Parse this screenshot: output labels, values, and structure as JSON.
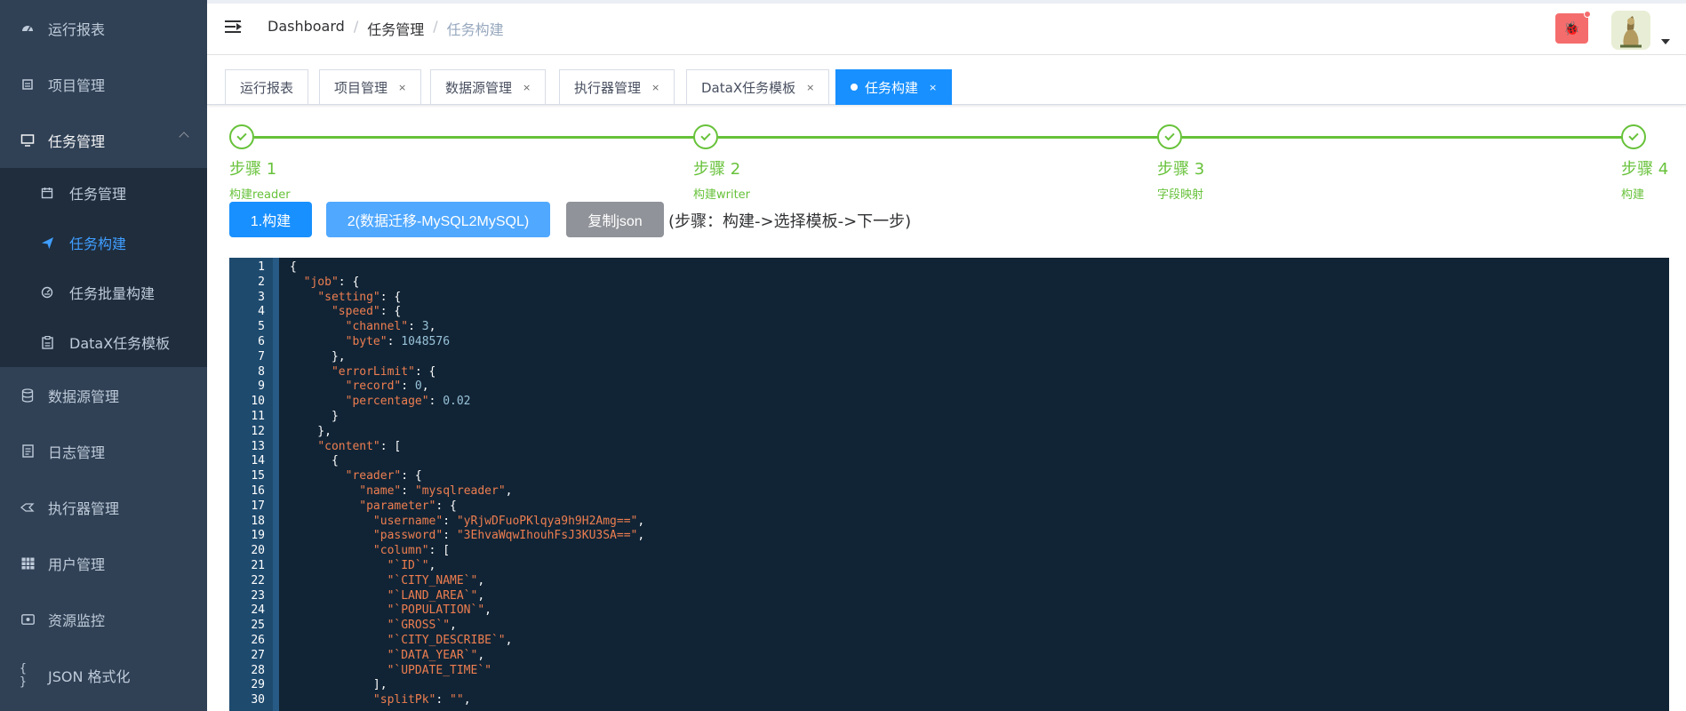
{
  "sidebar": {
    "items": [
      {
        "label": "运行报表",
        "icon": "dashboard-icon"
      },
      {
        "label": "项目管理",
        "icon": "project-icon"
      },
      {
        "label": "任务管理",
        "icon": "monitor-icon"
      }
    ],
    "submenu": [
      {
        "label": "任务管理",
        "icon": "calendar-icon"
      },
      {
        "label": "任务构建",
        "icon": "send-icon"
      },
      {
        "label": "任务批量构建",
        "icon": "batch-icon"
      },
      {
        "label": "DataX任务模板",
        "icon": "clipboard-icon"
      }
    ],
    "items_after": [
      {
        "label": "数据源管理",
        "icon": "database-icon"
      },
      {
        "label": "日志管理",
        "icon": "log-icon"
      },
      {
        "label": "执行器管理",
        "icon": "executor-icon"
      },
      {
        "label": "用户管理",
        "icon": "table-icon"
      },
      {
        "label": "资源监控",
        "icon": "monitor-resource-icon"
      },
      {
        "label": "JSON 格式化",
        "icon": "braces-icon"
      }
    ]
  },
  "header": {
    "breadcrumb": [
      "Dashboard",
      "任务管理",
      "任务构建"
    ],
    "bug_label": "🐞"
  },
  "tags": [
    {
      "label": "运行报表",
      "closable": false,
      "active": false
    },
    {
      "label": "项目管理",
      "closable": true,
      "active": false
    },
    {
      "label": "数据源管理",
      "closable": true,
      "active": false
    },
    {
      "label": "执行器管理",
      "closable": true,
      "active": false
    },
    {
      "label": "DataX任务模板",
      "closable": true,
      "active": false
    },
    {
      "label": "任务构建",
      "closable": true,
      "active": true
    }
  ],
  "close_glyph": "×",
  "steps": [
    {
      "title": "步骤 1",
      "desc": "构建reader"
    },
    {
      "title": "步骤 2",
      "desc": "构建writer"
    },
    {
      "title": "步骤 3",
      "desc": "字段映射"
    },
    {
      "title": "步骤 4",
      "desc": "构建"
    }
  ],
  "buttons": {
    "build": "1.构建",
    "template": "2(数据迁移-MySQL2MySQL)",
    "copy": "复制json",
    "hint": "(步骤：构建->选择模板->下一步)"
  },
  "code_lines": [
    "{",
    "  \"job\": {",
    "    \"setting\": {",
    "      \"speed\": {",
    "        \"channel\": 3,",
    "        \"byte\": 1048576",
    "      },",
    "      \"errorLimit\": {",
    "        \"record\": 0,",
    "        \"percentage\": 0.02",
    "      }",
    "    },",
    "    \"content\": [",
    "      {",
    "        \"reader\": {",
    "          \"name\": \"mysqlreader\",",
    "          \"parameter\": {",
    "            \"username\": \"yRjwDFuoPKlqya9h9H2Amg==\",",
    "            \"password\": \"3EhvaWqwIhouhFsJ3KU3SA==\",",
    "            \"column\": [",
    "              \"`ID`\",",
    "              \"`CITY_NAME`\",",
    "              \"`LAND_AREA`\",",
    "              \"`POPULATION`\",",
    "              \"`GROSS`\",",
    "              \"`CITY_DESCRIBE`\",",
    "              \"`DATA_YEAR`\",",
    "              \"`UPDATE_TIME`\"",
    "            ],",
    "            \"splitPk\": \"\","
  ],
  "colors": {
    "sidebar_bg": "#304156",
    "submenu_bg": "#1f2d3d",
    "primary": "#1890ff",
    "success": "#67c23a",
    "editor_bg": "#112435",
    "string": "#ee7e50",
    "number": "#99c3d9"
  }
}
